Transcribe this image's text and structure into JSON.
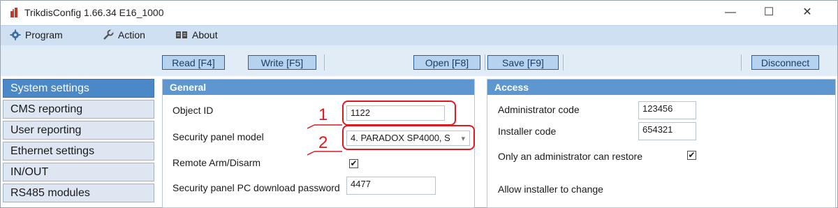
{
  "window": {
    "title": "TrikdisConfig 1.66.34   E16_1000",
    "minimize": "—",
    "maximize": "☐",
    "close": "✕"
  },
  "menu": {
    "program": "Program",
    "action": "Action",
    "about": "About"
  },
  "toolbar": {
    "read": "Read [F4]",
    "write": "Write [F5]",
    "open": "Open [F8]",
    "save": "Save [F9]",
    "disconnect": "Disconnect"
  },
  "sidebar": {
    "items": [
      {
        "label": "System settings",
        "active": true
      },
      {
        "label": "CMS reporting",
        "active": false
      },
      {
        "label": "User reporting",
        "active": false
      },
      {
        "label": "Ethernet settings",
        "active": false
      },
      {
        "label": "IN/OUT",
        "active": false
      },
      {
        "label": "RS485 modules",
        "active": false
      }
    ]
  },
  "general": {
    "title": "General",
    "object_id_label": "Object ID",
    "object_id_value": "1122",
    "panel_model_label": "Security panel model",
    "panel_model_value": "4. PARADOX SP4000, S",
    "remote_arm_label": "Remote Arm/Disarm",
    "remote_arm_checked": true,
    "pc_password_label": "Security panel PC download password",
    "pc_password_value": "4477"
  },
  "access": {
    "title": "Access",
    "admin_code_label": "Administrator code",
    "admin_code_value": "123456",
    "installer_code_label": "Installer code",
    "installer_code_value": "654321",
    "admin_restore_label": "Only an administrator can restore",
    "admin_restore_checked": true,
    "allow_installer_label": "Allow installer to change"
  },
  "callouts": {
    "one": "1",
    "two": "2"
  },
  "colors": {
    "accent": "#4a88c7",
    "panel_header": "#5e97cf",
    "callout": "#e0191f",
    "menubar": "#cfe0f2"
  }
}
